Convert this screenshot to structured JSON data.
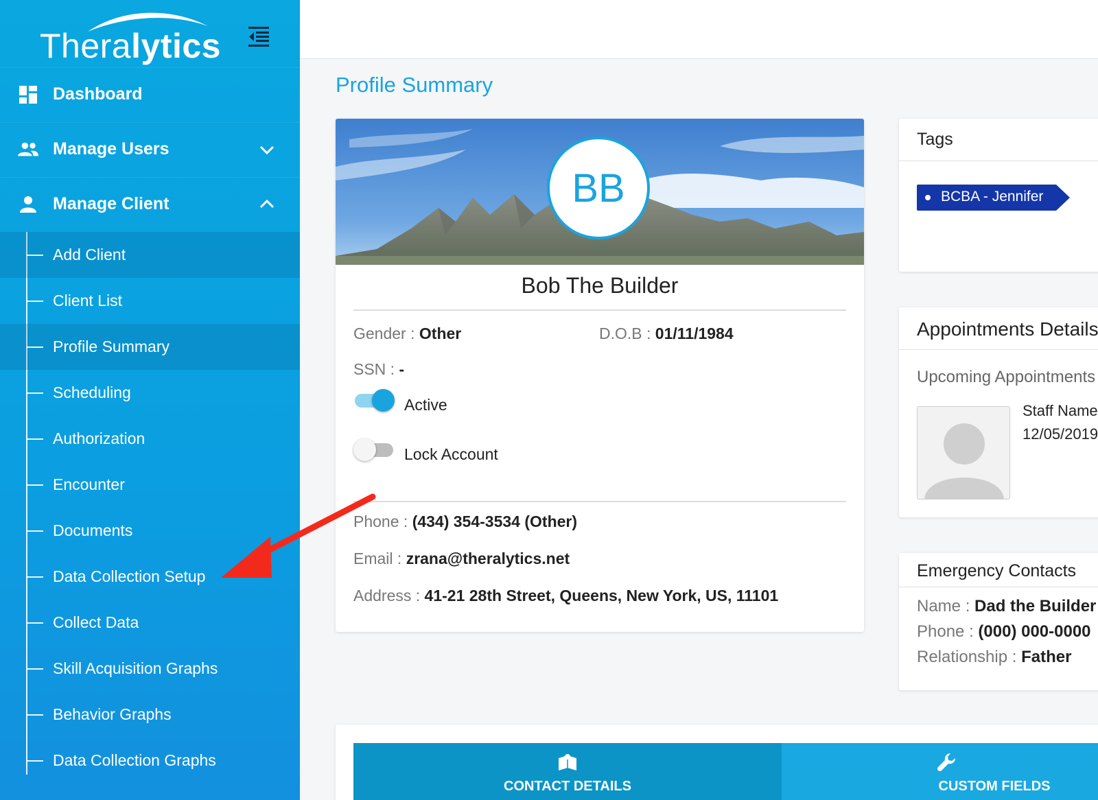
{
  "brand": {
    "logo_light": "Thera",
    "logo_bold": "lytics"
  },
  "sidebar": {
    "items": [
      {
        "label": "Dashboard",
        "icon": "dashboard-icon"
      },
      {
        "label": "Manage Users",
        "icon": "users-icon"
      },
      {
        "label": "Manage Client",
        "icon": "person-icon"
      }
    ],
    "subitems": [
      "Add Client",
      "Client List",
      "Profile Summary",
      "Scheduling",
      "Authorization",
      "Encounter",
      "Documents",
      "Data Collection Setup",
      "Collect Data",
      "Skill Acquisition Graphs",
      "Behavior Graphs",
      "Data Collection Graphs"
    ]
  },
  "page": {
    "title": "Profile Summary"
  },
  "profile": {
    "initials": "BB",
    "name": "Bob The Builder",
    "gender_label": "Gender : ",
    "gender": "Other",
    "dob_label": "D.O.B : ",
    "dob": "01/11/1984",
    "ssn_label": "SSN : ",
    "ssn": "-",
    "active_label": "Active",
    "active": true,
    "lock_label": "Lock Account",
    "lock": false,
    "phone_label": "Phone : ",
    "phone": "(434) 354-3534 (Other)",
    "email_label": "Email : ",
    "email": "zrana@theralytics.net",
    "address_label": "Address : ",
    "address": "41-21 28th Street, Queens, New York, US, 11101"
  },
  "tags": {
    "title": "Tags",
    "items": [
      "BCBA - Jennifer"
    ]
  },
  "appointments": {
    "title": "Appointments Details",
    "upcoming": "Upcoming Appointments",
    "staff_line": "Staff Name",
    "date_line": "12/05/2019"
  },
  "emergency": {
    "title": "Emergency Contacts",
    "name_label": "Name : ",
    "name": "Dad the  Builder",
    "phone_label": "Phone : ",
    "phone": "(000) 000-0000",
    "relationship_label": "Relationship : ",
    "relationship": "Father"
  },
  "tabs": [
    {
      "label": "CONTACT DETAILS",
      "icon": "contact-book-icon",
      "active": true
    },
    {
      "label": "CUSTOM FIELDS",
      "icon": "wrench-icon",
      "active": false
    }
  ],
  "colors": {
    "sidebar": "#0aa7e0",
    "accent": "#1aa4de",
    "tag": "#1436a8",
    "annotation_arrow": "#f22a1c",
    "tab_indicator": "#4cc36c"
  }
}
